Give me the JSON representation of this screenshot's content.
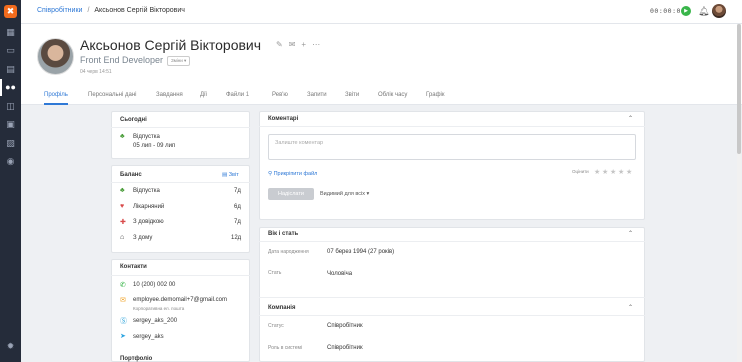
{
  "sidebar": {
    "logo": "✖",
    "icons": [
      "grid-icon",
      "calendar-icon",
      "book-icon",
      "users-icon",
      "layers-icon",
      "report-icon",
      "chart-icon",
      "person-circle-icon",
      "gear-icon"
    ]
  },
  "breadcrumb": {
    "parent": "Співробітники",
    "separator": "/",
    "current": "Аксьонов Сергій Вікторович"
  },
  "timer": "00:00:00",
  "profile": {
    "name": "Аксьонов Сергій Вікторович",
    "position": "Front End Developer",
    "badge": "Зміни ▾",
    "date": "04 черв 14:51"
  },
  "tabs": [
    {
      "label": "Профіль"
    },
    {
      "label": "Персональні дані"
    },
    {
      "label": "Завдання"
    },
    {
      "label": "Дії"
    },
    {
      "label": "Файли",
      "count": "1"
    },
    {
      "label": "Рев'ю"
    },
    {
      "label": "Запити"
    },
    {
      "label": "Звіти"
    },
    {
      "label": "Облік часу"
    },
    {
      "label": "Графік"
    }
  ],
  "today": {
    "title": "Сьогодні",
    "status": "Відпустка",
    "range": "05 лип - 09 лип"
  },
  "balance": {
    "title": "Баланс",
    "report": "Звіт",
    "items": [
      {
        "label": "Відпустка",
        "value": "7д"
      },
      {
        "label": "Лікарняний",
        "value": "6д"
      },
      {
        "label": "З довідкою",
        "value": "7д"
      },
      {
        "label": "З дому",
        "value": "12д"
      }
    ]
  },
  "contacts": {
    "title": "Контакти",
    "phone": "10 (200) 002 00",
    "email": "employee.demomail+7@gmail.com",
    "email_note": "Корпоративна ел. пошта",
    "skype": "sergey_aks_200",
    "telegram": "sergey_aks",
    "next_title": "Портфоліо"
  },
  "comments": {
    "title": "Коментарі",
    "placeholder": "Залиште коментар",
    "attach": "Прикріпити файл",
    "rating_label": "Оцінити",
    "submit": "Надіслати",
    "visibility": "Видимий для всіх ▾"
  },
  "age": {
    "title": "Вік і стать",
    "dob_label": "Дата народження",
    "dob": "07 берез 1994 (27 років)",
    "sex_label": "Стать",
    "sex": "Чоловіча"
  },
  "company": {
    "title": "Компанія",
    "status_label": "Статус",
    "status": "Співробітник",
    "role_label": "Роль в системі",
    "role": "Співробітник"
  },
  "colors": {
    "accent": "#2f79d6",
    "logo": "#f26b1d",
    "sidebar": "#252c3a",
    "play": "#39b54a"
  }
}
